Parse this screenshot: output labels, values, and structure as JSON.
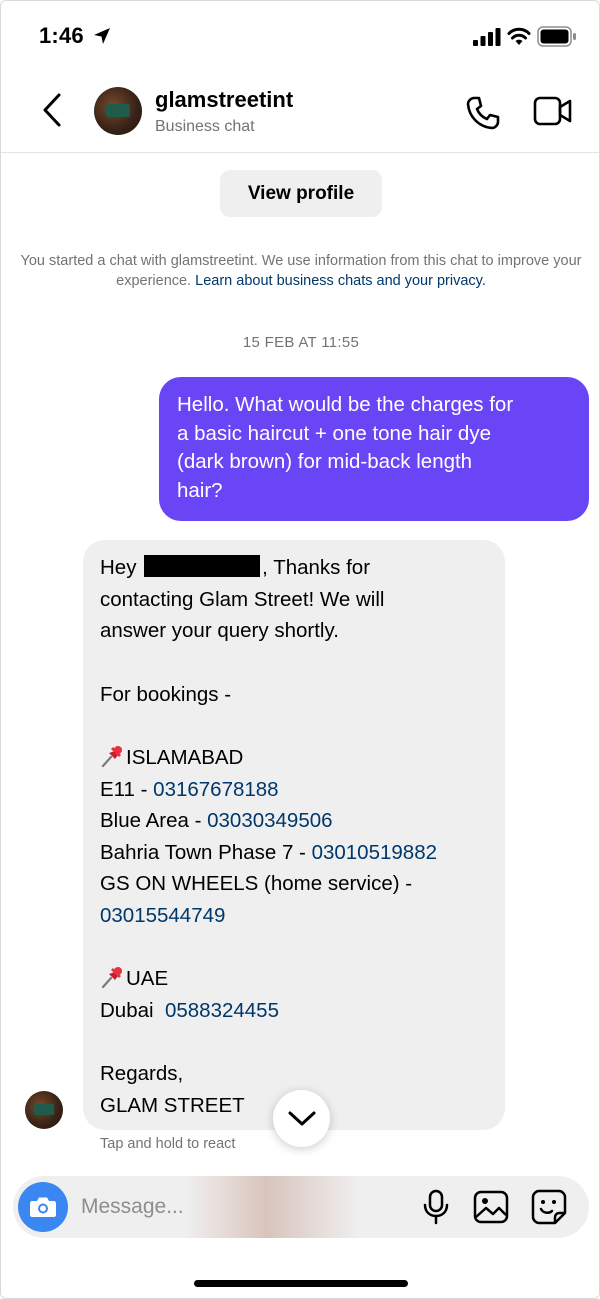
{
  "status_bar": {
    "time": "1:46"
  },
  "header": {
    "contact_name": "glamstreetint",
    "contact_subtitle": "Business chat",
    "back_icon": "chevron-left-icon",
    "call_icon": "phone-icon",
    "video_icon": "video-camera-icon"
  },
  "view_profile_label": "View profile",
  "privacy_note": {
    "text": "You started a chat with glamstreetint. We use information from this chat to improve your experience.",
    "link": "Learn about business chats and your privacy."
  },
  "date_separator": "15 FEB AT 11:55",
  "sent_message": {
    "lines": [
      "Hello. What would be the charges for",
      "a basic haircut + one tone hair dye",
      "(dark brown) for mid-back length",
      "hair?"
    ]
  },
  "received_message": {
    "greeting_before": "Hey",
    "greeting_after": ", Thanks for",
    "line2": "contacting Glam Street! We will",
    "line3": "answer your query shortly.",
    "bookings_heading": "For bookings -",
    "islamabad_heading": "ISLAMABAD",
    "e11_label": "E11 - ",
    "e11_phone": "03167678188",
    "blue_area_label": "Blue Area - ",
    "blue_area_phone": "03030349506",
    "bahria_label": "Bahria Town Phase 7 - ",
    "bahria_phone": "03010519882",
    "gs_wheels_label": "GS ON WHEELS (home service) -",
    "gs_wheels_phone": "03015544749",
    "uae_heading": "UAE",
    "dubai_label": "Dubai  ",
    "dubai_phone": "0588324455",
    "regards": "Regards,",
    "signature": "GLAM STREET"
  },
  "tap_hint": "Tap and hold to react",
  "composer": {
    "placeholder": "Message...",
    "camera_icon": "camera-icon",
    "mic_icon": "microphone-icon",
    "gallery_icon": "image-gallery-icon",
    "sticker_icon": "sticker-icon"
  },
  "colors": {
    "sent_bubble": "#6a45f5",
    "received_bubble": "#efefef",
    "link": "#00376b",
    "camera_button": "#3b87f2"
  }
}
